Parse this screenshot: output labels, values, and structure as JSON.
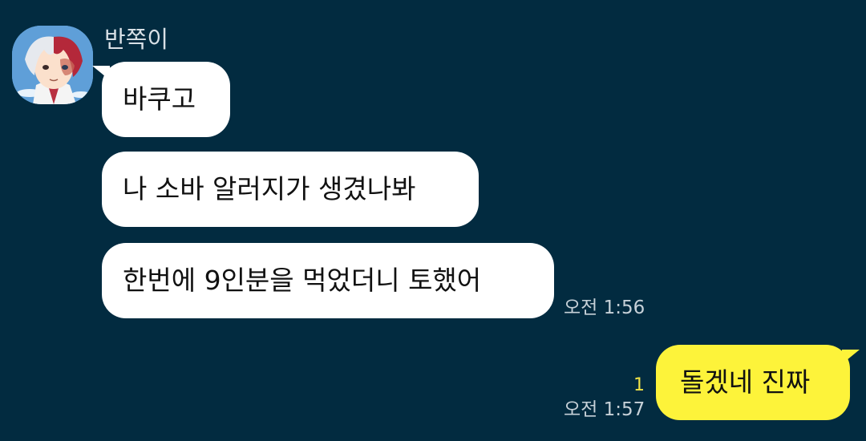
{
  "chat": {
    "sender_name": "반쪽이",
    "incoming": [
      {
        "text": "바쿠고"
      },
      {
        "text": "나 소바 알러지가 생겼나봐"
      },
      {
        "text": "한번에 9인분을 먹었더니 토했어"
      }
    ],
    "incoming_time": "오전 1:56",
    "outgoing": [
      {
        "text": "돌겠네 진짜",
        "unread_count": "1"
      }
    ],
    "outgoing_time": "오전 1:57"
  },
  "colors": {
    "background": "#022b40",
    "incoming_bubble": "#ffffff",
    "outgoing_bubble": "#fdf33a",
    "unread_count": "#f0e246"
  },
  "icons": {
    "avatar": "profile-avatar-anime-character"
  }
}
